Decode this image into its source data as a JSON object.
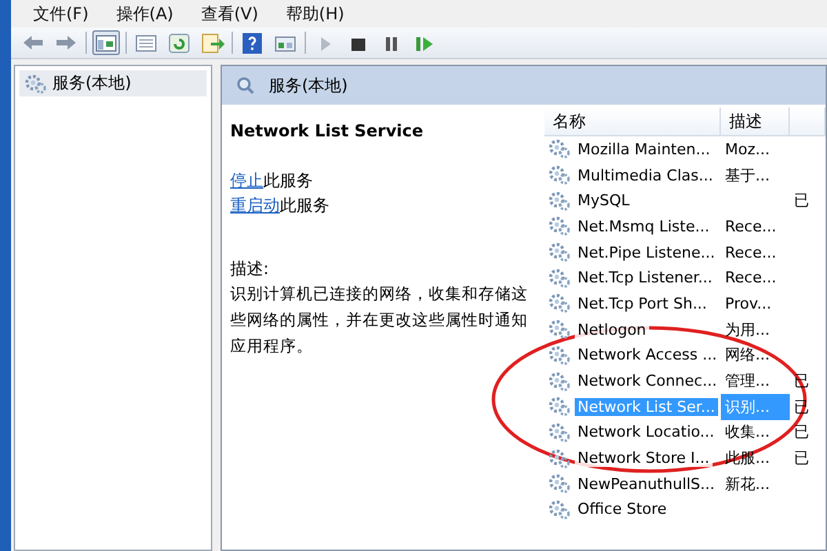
{
  "menu": [
    "文件(F)",
    "操作(A)",
    "查看(V)",
    "帮助(H)"
  ],
  "toolbar": [
    {
      "kind": "back",
      "disabled": false,
      "pressed": false
    },
    {
      "kind": "forward",
      "disabled": false,
      "pressed": false
    },
    {
      "kind": "sep"
    },
    {
      "kind": "tree",
      "disabled": false,
      "pressed": true
    },
    {
      "kind": "sep"
    },
    {
      "kind": "properties",
      "disabled": false,
      "pressed": false
    },
    {
      "kind": "refresh",
      "disabled": false,
      "pressed": false
    },
    {
      "kind": "export",
      "disabled": false,
      "pressed": false
    },
    {
      "kind": "sep"
    },
    {
      "kind": "help",
      "disabled": false,
      "pressed": false
    },
    {
      "kind": "console",
      "disabled": false,
      "pressed": false
    },
    {
      "kind": "sep"
    },
    {
      "kind": "play",
      "disabled": true,
      "pressed": false
    },
    {
      "kind": "stop",
      "disabled": false,
      "pressed": false
    },
    {
      "kind": "pause",
      "disabled": false,
      "pressed": false
    },
    {
      "kind": "resume",
      "disabled": false,
      "pressed": false
    }
  ],
  "tree": {
    "items": [
      {
        "label": "服务(本地)",
        "selected": true
      }
    ]
  },
  "pane_title": "服务(本地)",
  "detail": {
    "title": "Network List Service",
    "actions": [
      {
        "link": "停止",
        "text": "此服务"
      },
      {
        "link": "重启动",
        "text": "此服务"
      }
    ],
    "description_label": "描述:",
    "description": "识别计算机已连接的网络，收集和存储这些网络的属性，并在更改这些属性时通知应用程序。"
  },
  "table": {
    "columns": [
      "名称",
      "描述"
    ],
    "rows": [
      {
        "name": "Mozilla Mainten...",
        "description": "Moz...",
        "selected": false
      },
      {
        "name": "Multimedia Clas...",
        "description": "基于...",
        "selected": false
      },
      {
        "name": "MySQL",
        "column_3": "已",
        "selected": false
      },
      {
        "name": "Net.Msmq Liste...",
        "description": "Rece...",
        "selected": false
      },
      {
        "name": "Net.Pipe Listene...",
        "description": "Rece...",
        "selected": false
      },
      {
        "name": "Net.Tcp Listener...",
        "description": "Rece...",
        "selected": false
      },
      {
        "name": "Net.Tcp Port Sh...",
        "description": "Prov...",
        "selected": false
      },
      {
        "name": "Netlogon",
        "description": "为用...",
        "selected": false
      },
      {
        "name": "Network Access ...",
        "description": "网络...",
        "selected": false
      },
      {
        "name": "Network Connec...",
        "description": "管理...",
        "column_3": "已",
        "selected": false
      },
      {
        "name": "Network List Ser...",
        "description": "识别...",
        "column_3": "已",
        "selected": true
      },
      {
        "name": "Network Locatio...",
        "description": "收集...",
        "column_3": "已",
        "selected": false
      },
      {
        "name": "Network Store I...",
        "description": "此服...",
        "column_3": "已",
        "selected": false
      },
      {
        "name": "NewPeanuthullS...",
        "description": "新花...",
        "selected": false
      },
      {
        "name": "Office Store",
        "selected": false
      }
    ]
  },
  "annotation": {
    "kind": "ellipse"
  }
}
